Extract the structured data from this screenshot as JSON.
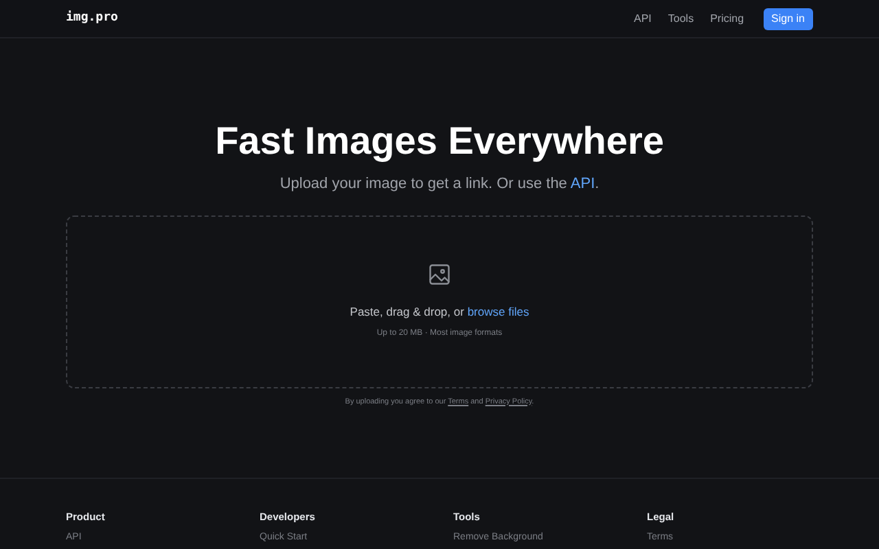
{
  "header": {
    "logo": "img.pro",
    "nav": [
      "API",
      "Tools",
      "Pricing"
    ],
    "button": "Sign in"
  },
  "hero": {
    "title": "Fast Images Everywhere",
    "subtitle": "Upload your image to get a link. Or use the",
    "subtitle_link": "API",
    "subtitle_end": "."
  },
  "dropzone": {
    "prompt": "Paste, drag & drop, or",
    "browse": "browse files",
    "hint": "Up to 20 MB · Most image formats"
  },
  "consent": {
    "text": "By uploading you agree to our",
    "terms": "Terms",
    "and": "and",
    "privacy": "Privacy Policy",
    "end": "."
  },
  "footer": [
    {
      "heading": "Product",
      "links": [
        "API"
      ]
    },
    {
      "heading": "Developers",
      "links": [
        "Quick Start"
      ]
    },
    {
      "heading": "Tools",
      "links": [
        "Remove Background"
      ]
    },
    {
      "heading": "Legal",
      "links": [
        "Terms"
      ]
    }
  ]
}
